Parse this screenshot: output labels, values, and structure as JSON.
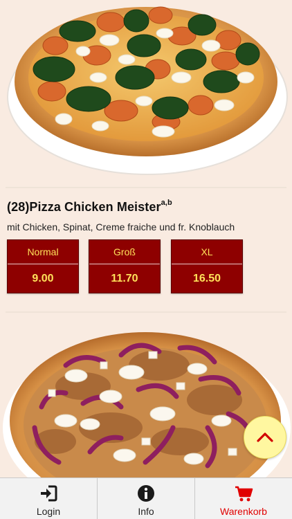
{
  "item": {
    "title": "(28)Pizza Chicken Meister",
    "superscript": "a,b",
    "description": "mit Chicken, Spinat, Creme fraiche und fr. Knoblauch",
    "prices": [
      {
        "size": "Normal",
        "price": "9.00"
      },
      {
        "size": "Groß",
        "price": "11.70"
      },
      {
        "size": "XL",
        "price": "16.50"
      }
    ]
  },
  "nav": {
    "items": [
      {
        "label": "Login",
        "icon": "login-icon"
      },
      {
        "label": "Info",
        "icon": "info-icon"
      },
      {
        "label": "Warenkorb",
        "icon": "cart-icon",
        "active": true
      }
    ]
  },
  "colors": {
    "background": "#f9ebe1",
    "price_button": "#8e0000",
    "price_text": "#ffe15a",
    "scroll_button": "#fff7a0",
    "active_nav": "#e00000"
  }
}
